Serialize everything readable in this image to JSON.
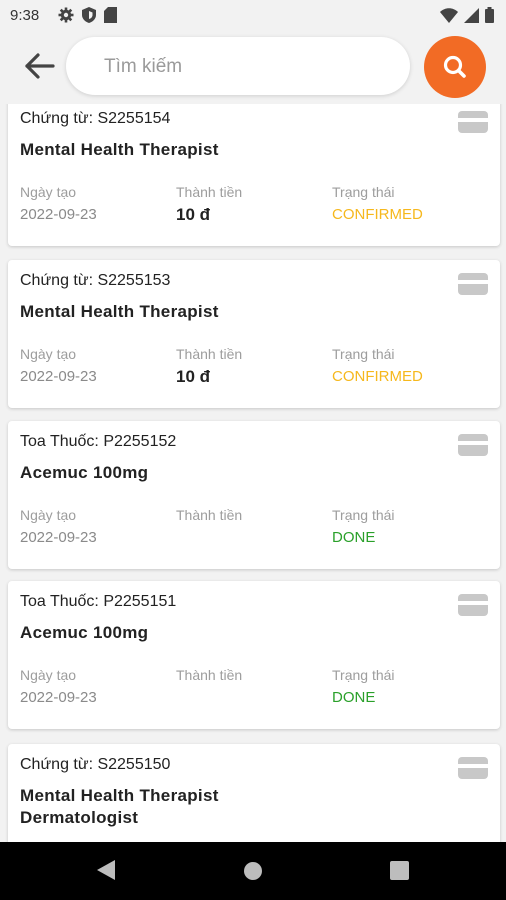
{
  "status_bar": {
    "time": "9:38",
    "icons": [
      "gear-icon",
      "shield-icon",
      "sim-card-icon",
      "wifi-icon",
      "signal-icon",
      "battery-icon"
    ]
  },
  "search": {
    "placeholder": "Tìm kiếm",
    "value": ""
  },
  "colors": {
    "accent": "#f26b25",
    "confirmed": "#f6b81d",
    "done": "#2aa02a"
  },
  "labels": {
    "created": "Ngày tạo",
    "amount": "Thành tiền",
    "status": "Trạng thái"
  },
  "records": [
    {
      "doc": "Chứng từ: S2255154",
      "title": "Mental Health Therapist",
      "date": "2022-09-23",
      "amount": "10 đ",
      "status": "CONFIRMED"
    },
    {
      "doc": "Chứng từ: S2255153",
      "title": "Mental Health Therapist",
      "date": "2022-09-23",
      "amount": "10 đ",
      "status": "CONFIRMED"
    },
    {
      "doc": "Toa Thuốc: P2255152",
      "title": "Acemuc 100mg",
      "date": "2022-09-23",
      "amount": "",
      "status": "DONE"
    },
    {
      "doc": "Toa Thuốc: P2255151",
      "title": "Acemuc 100mg",
      "date": "2022-09-23",
      "amount": "",
      "status": "DONE"
    },
    {
      "doc": "Chứng từ: S2255150",
      "title_lines": [
        "Mental Health Therapist",
        "Dermatologist"
      ]
    }
  ],
  "nav": [
    "back-triangle-icon",
    "home-circle-icon",
    "recents-square-icon"
  ]
}
